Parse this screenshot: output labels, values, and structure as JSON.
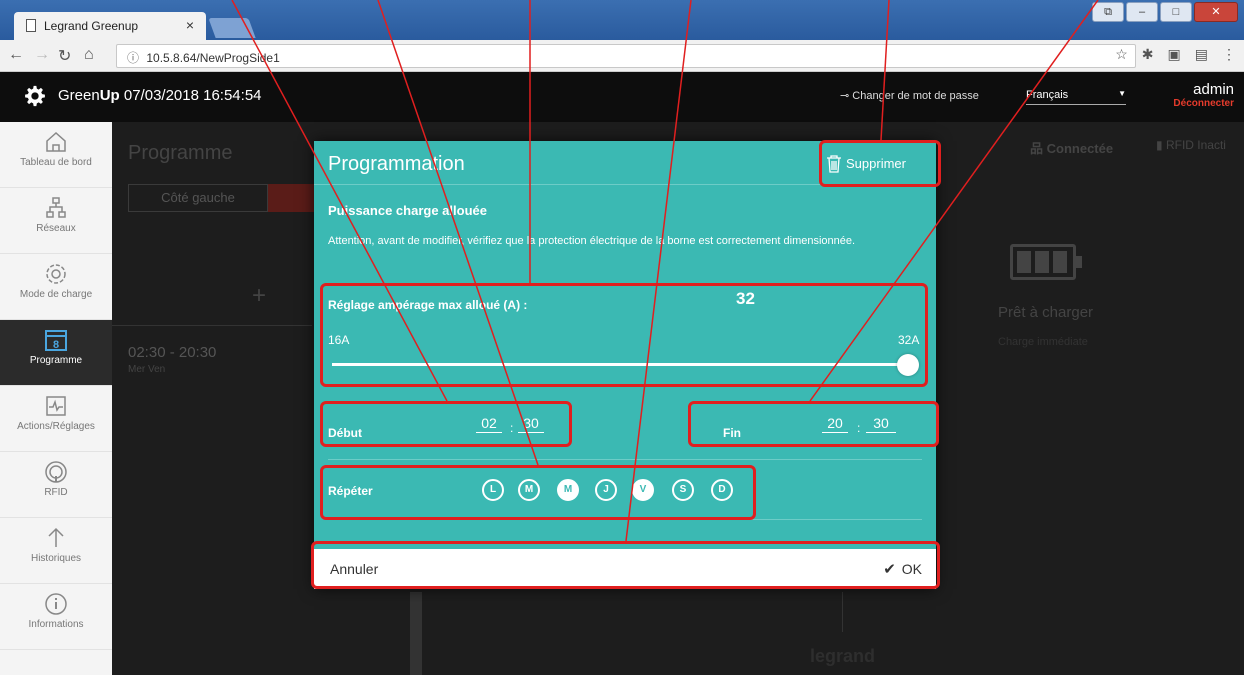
{
  "browser": {
    "tab_title": "Legrand Greenup",
    "tab_close": "×",
    "url": "10.5.8.64/NewProgSide1"
  },
  "app": {
    "brand_prefix": "Green",
    "brand_bold": "Up",
    "datetime": "07/03/2018 16:54:54",
    "change_password": "Changer de mot de passe",
    "language": "Français",
    "username": "admin",
    "logout": "Déconnecter"
  },
  "sidebar": {
    "items": [
      {
        "label": "Tableau de bord",
        "icon": "home-icon"
      },
      {
        "label": "Réseaux",
        "icon": "network-icon"
      },
      {
        "label": "Mode de charge",
        "icon": "settings-gear-icon"
      },
      {
        "label": "Programme",
        "icon": "calendar-icon",
        "active": true,
        "badge": "8"
      },
      {
        "label": "Actions/Réglages",
        "icon": "activity-icon"
      },
      {
        "label": "RFID",
        "icon": "rfid-icon"
      },
      {
        "label": "Historiques",
        "icon": "arrow-up-icon"
      },
      {
        "label": "Informations",
        "icon": "info-icon"
      }
    ]
  },
  "background": {
    "title": "Programme",
    "segment_left": "Côté gauche",
    "plus": "+",
    "schedule_time": "02:30 - 20:30",
    "schedule_days": "Mer Ven",
    "connected": "Connectée",
    "rfid_status": "RFID Inacti",
    "ready": "Prêt à charger",
    "immediate": "Charge immédiate",
    "brand_footer": "legrand"
  },
  "modal": {
    "title": "Programmation",
    "delete_label": "Supprimer",
    "power_title": "Puissance charge allouée",
    "warning": "Attention, avant de modifier, vérifiez que la protection électrique de la borne est correctement dimensionnée.",
    "amperage_label": "Réglage ampérage max alloué (A) :",
    "amperage_value": "32",
    "amperage_min": "16A",
    "amperage_max": "32A",
    "amperage_fraction": 1.0,
    "start_label": "Début",
    "start_hour": "02",
    "start_minute": "30",
    "end_label": "Fin",
    "end_hour": "20",
    "end_minute": "30",
    "time_separator": ":",
    "repeat_label": "Répéter",
    "days": [
      {
        "letter": "L",
        "selected": false
      },
      {
        "letter": "M",
        "selected": false
      },
      {
        "letter": "M",
        "selected": true
      },
      {
        "letter": "J",
        "selected": false
      },
      {
        "letter": "V",
        "selected": true
      },
      {
        "letter": "S",
        "selected": false
      },
      {
        "letter": "D",
        "selected": false
      }
    ],
    "cancel_label": "Annuler",
    "ok_label": "OK"
  },
  "colors": {
    "modal_teal": "#3bb9b3",
    "annotation_red": "#e01f1f",
    "logout_red": "#e53b2c",
    "header_black": "#0d0d0d"
  }
}
